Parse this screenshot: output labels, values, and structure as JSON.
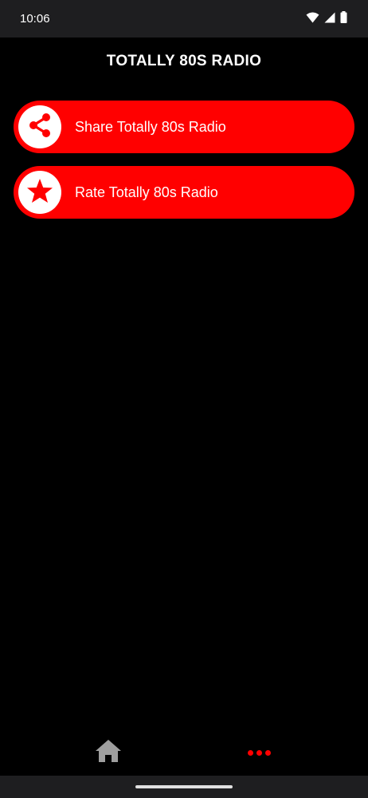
{
  "status_bar": {
    "time": "10:06",
    "icons": [
      "wifi-icon",
      "signal-icon",
      "battery-icon"
    ]
  },
  "header": {
    "title": "TOTALLY 80S RADIO"
  },
  "menu": {
    "items": [
      {
        "label": "Share Totally 80s Radio",
        "icon": "share-icon"
      },
      {
        "label": "Rate Totally 80s Radio",
        "icon": "star-icon"
      }
    ]
  },
  "bottom_nav": {
    "items": [
      {
        "icon": "home-icon",
        "active": false
      },
      {
        "icon": "more-icon",
        "active": true
      }
    ]
  },
  "colors": {
    "accent": "#ff0000",
    "background": "#000000",
    "status_bar": "#1e1e20",
    "inactive_icon": "#9e9e9e"
  }
}
